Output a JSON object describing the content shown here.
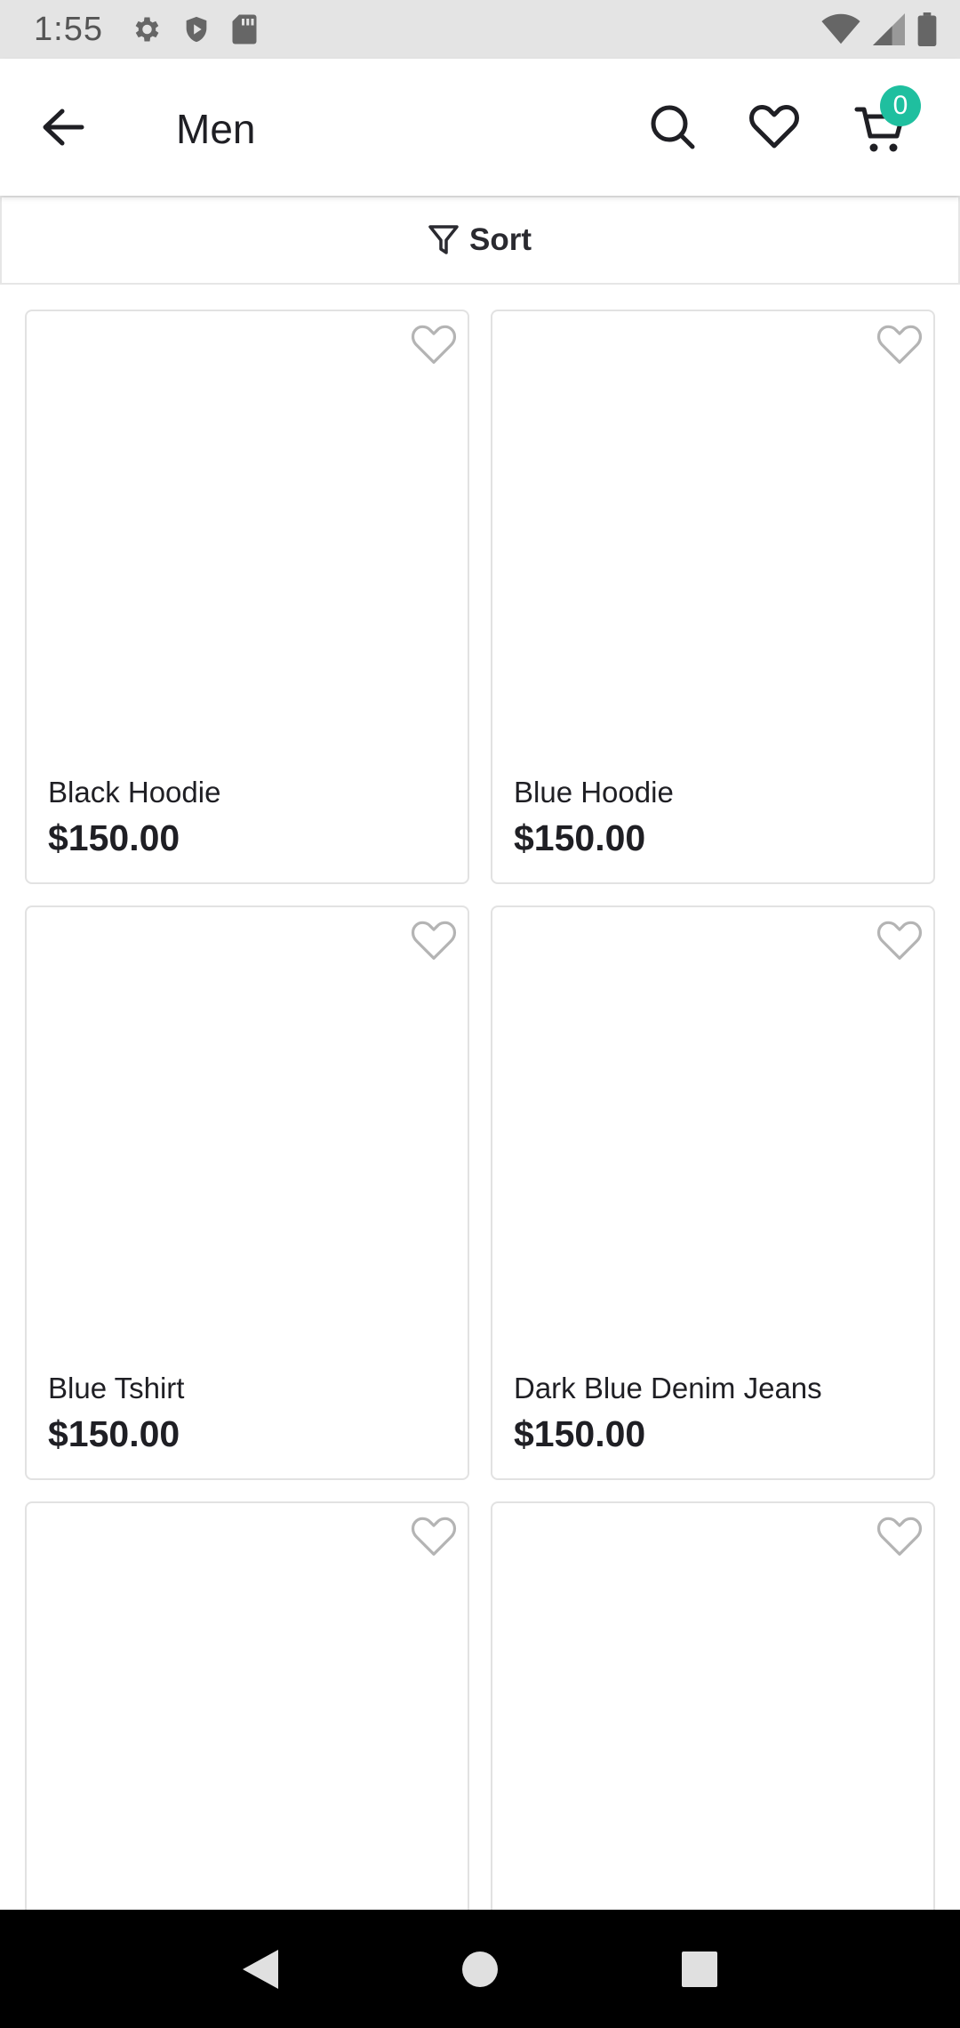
{
  "status_bar": {
    "time": "1:55",
    "icons": [
      "settings-icon",
      "shield-play-icon",
      "sd-card-icon",
      "wifi-icon",
      "signal-icon",
      "battery-icon"
    ],
    "color": "#e4e4e4"
  },
  "app_bar": {
    "title": "Men",
    "cart_count": "0",
    "badge_color": "#1fbf9f",
    "icons": [
      "back-arrow-icon",
      "search-icon",
      "heart-icon",
      "cart-icon"
    ]
  },
  "sort_bar": {
    "label": "Sort",
    "icon": "filter-funnel-icon"
  },
  "products": [
    {
      "name": "Black Hoodie",
      "price": "$150.00"
    },
    {
      "name": "Blue Hoodie",
      "price": "$150.00"
    },
    {
      "name": "Blue Tshirt",
      "price": "$150.00"
    },
    {
      "name": "Dark Blue Denim Jeans",
      "price": "$150.00"
    },
    {
      "name": "",
      "price": ""
    },
    {
      "name": "",
      "price": ""
    }
  ],
  "nav_bar": {
    "icons": [
      "back-triangle-icon",
      "home-circle-icon",
      "recents-square-icon"
    ]
  }
}
